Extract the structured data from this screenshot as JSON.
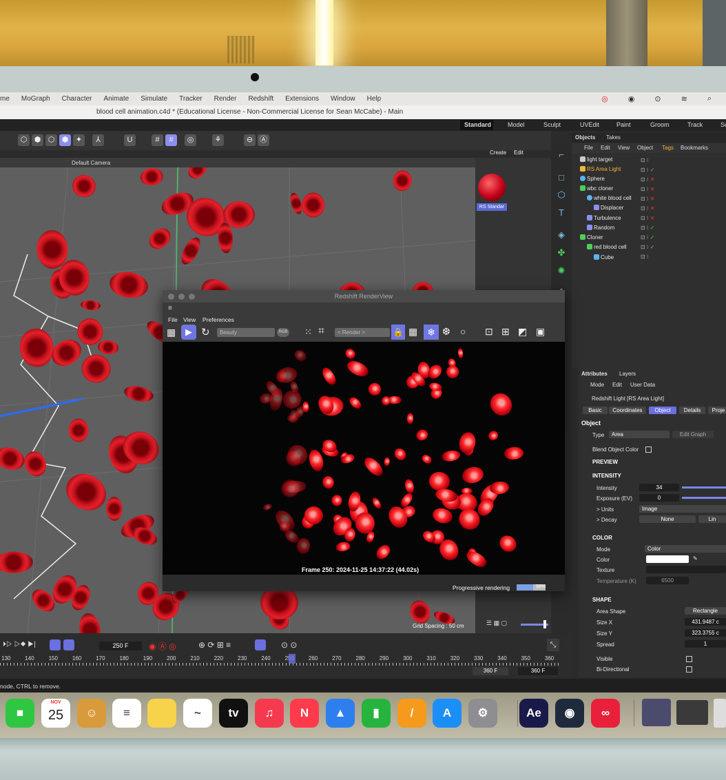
{
  "menubar": {
    "items": [
      "me",
      "MoGraph",
      "Character",
      "Animate",
      "Simulate",
      "Tracker",
      "Render",
      "Redshift",
      "Extensions",
      "Window",
      "Help"
    ]
  },
  "window_title": "blood cell animation.c4d * (Educational License - Non-Commercial License for Sean McCabe) - Main",
  "layouts": [
    "Standard",
    "Model",
    "Sculpt",
    "UVEdit",
    "Paint",
    "Groom",
    "Track",
    "Sc"
  ],
  "viewport": {
    "camera": "Default Camera",
    "grid_spacing": "Grid Spacing : 50 cm"
  },
  "create_panel": {
    "create": "Create",
    "edit": "Edit",
    "material": "RS Standar"
  },
  "objects": {
    "tabs": [
      "Objects",
      "Takes"
    ],
    "menu": [
      "File",
      "Edit",
      "View",
      "Object",
      "Tags",
      "Bookmarks"
    ],
    "rows": [
      "light target",
      "RS Area Light",
      "Sphere",
      "wbc cloner",
      "white blood cell",
      "Displacer",
      "Turbulence",
      "Random",
      "Cloner",
      "red blood cell",
      "Cube"
    ]
  },
  "renderview": {
    "title": "Redshift RenderView",
    "menu": [
      "File",
      "View",
      "Preferences"
    ],
    "aov": "Beauty",
    "rgb": "RGB",
    "render_select": "< Render >",
    "frame_info": "Frame 250: 2024-11-25 14:37:22 (44.02s)",
    "progress_label": "Progressive rendering",
    "progress_text": "58%",
    "progress": 0.58
  },
  "attributes": {
    "tabs": [
      "Attributes",
      "Layers"
    ],
    "menu": [
      "Mode",
      "Edit",
      "User Data"
    ],
    "object_title": "Redshift Light [RS Area Light]",
    "subtabs": [
      "Basic",
      "Coordinates",
      "Object",
      "Details",
      "Proje"
    ],
    "section_object": "Object",
    "type_label": "Type",
    "type_value": "Area",
    "edit_graph": "Edit Graph",
    "blend_label": "Blend Object Color",
    "preview": "PREVIEW",
    "intensity_section": "INTENSITY",
    "intensity_label": "Intensity",
    "intensity_value": "34",
    "exposure_label": "Exposure (EV)",
    "exposure_value": "0",
    "units_label": "> Units",
    "units_value": "Image",
    "decay_label": "> Decay",
    "decay_value": "None",
    "decay_value2": "Lin",
    "color_section": "COLOR",
    "mode_label": "Mode",
    "mode_value": "Color",
    "color_label": "Color",
    "texture_label": "Texture",
    "temp_label": "Temperature (K)",
    "temp_value": "6500",
    "shape_section": "SHAPE",
    "area_shape_label": "Area Shape",
    "area_shape_value": "Rectangle",
    "sizex_label": "Size X",
    "sizex_value": "431.9487 c",
    "sizey_label": "Size Y",
    "sizey_value": "323.3755 c",
    "spread_label": "Spread",
    "spread_value": "1",
    "visible_label": "Visible",
    "bidir_label": "Bi-Directional"
  },
  "timeline": {
    "current_frame": "250 F",
    "ticks": [
      "130",
      "140",
      "150",
      "160",
      "170",
      "180",
      "190",
      "200",
      "210",
      "220",
      "230",
      "240",
      "250",
      "260",
      "270",
      "280",
      "290",
      "300",
      "310",
      "320",
      "330",
      "340",
      "350",
      "360"
    ],
    "end1": "360 F",
    "end2": "360 F"
  },
  "status": "node, CTRL to remove.",
  "calendar": {
    "month": "NOV",
    "day": "25"
  },
  "dock": [
    {
      "name": "FaceTime",
      "color": "#2fc742",
      "glyph": "■"
    },
    {
      "name": "Calendar",
      "color": "#ffffff",
      "glyph": ""
    },
    {
      "name": "Contacts",
      "color": "#d99a3c",
      "glyph": "☺"
    },
    {
      "name": "Reminders",
      "color": "#ffffff",
      "glyph": "≡"
    },
    {
      "name": "Notes",
      "color": "#f6d34a",
      "glyph": ""
    },
    {
      "name": "Freeform",
      "color": "#ffffff",
      "glyph": "~"
    },
    {
      "name": "TV",
      "color": "#111111",
      "glyph": "tv"
    },
    {
      "name": "Music",
      "color": "#f53a50",
      "glyph": "♫"
    },
    {
      "name": "News",
      "color": "#ff3b4b",
      "glyph": "N"
    },
    {
      "name": "Keynote",
      "color": "#2d7ff0",
      "glyph": "▲"
    },
    {
      "name": "Numbers",
      "color": "#26b43e",
      "glyph": "▮"
    },
    {
      "name": "Pages",
      "color": "#f59a1c",
      "glyph": "/"
    },
    {
      "name": "App Store",
      "color": "#1c8ef7",
      "glyph": "A"
    },
    {
      "name": "System Settings",
      "color": "#8d8d92",
      "glyph": "⚙"
    },
    {
      "name": "After Effects",
      "color": "#1a1a4a",
      "glyph": "Ae"
    },
    {
      "name": "Cinema 4D",
      "color": "#1f2a3c",
      "glyph": "◉"
    },
    {
      "name": "Creative Cloud",
      "color": "#e8203a",
      "glyph": "∞"
    }
  ]
}
